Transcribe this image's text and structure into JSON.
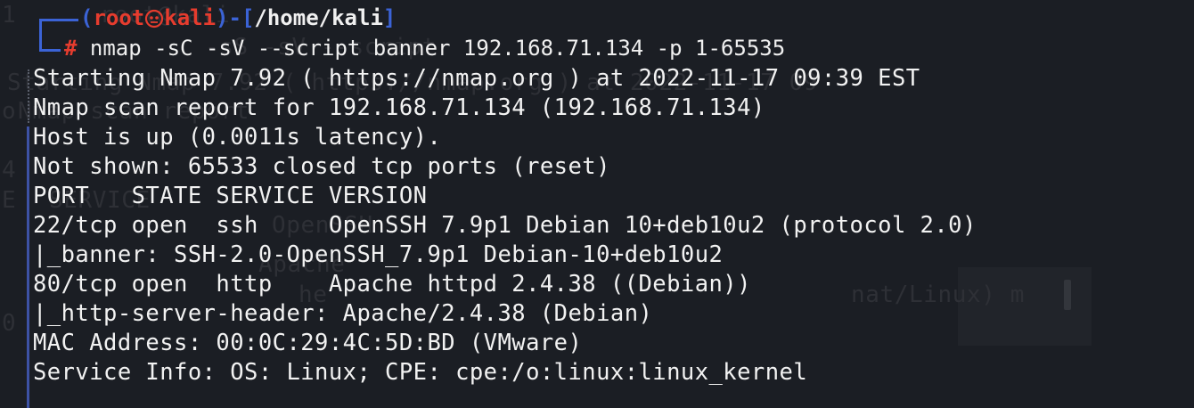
{
  "terminal": {
    "prompt": {
      "open_paren": "(",
      "user": "root",
      "host": "kali",
      "close_paren": ")-[",
      "path": "/home/kali",
      "close_bracket": "]",
      "symbol": "#",
      "command": " nmap -sC -sV --script banner 192.168.71.134 -p 1-65535"
    },
    "output_lines": [
      "Starting Nmap 7.92 ( https://nmap.org ) at 2022-11-17 09:39 EST",
      "Nmap scan report for 192.168.71.134 (192.168.71.134)",
      "Host is up (0.0011s latency).",
      "Not shown: 65533 closed tcp ports (reset)",
      "PORT   STATE SERVICE VERSION",
      "22/tcp open  ssh     OpenSSH 7.9p1 Debian 10+deb10u2 (protocol 2.0)",
      "|_banner: SSH-2.0-OpenSSH_7.9p1 Debian-10+deb10u2",
      "80/tcp open  http    Apache httpd 2.4.38 ((Debian))",
      "|_http-server-header: Apache/2.4.38 (Debian)",
      "MAC Address: 00:0C:29:4C:5D:BD (VMware)",
      "Service Info: OS: Linux; CPE: cpe:/o:linux:linux_kernel"
    ]
  },
  "background_ghost": {
    "fragments": [
      "1",
      "root@kali",
      "-sS -sV --script",
      "Starting Nmap 7.92 ( https://nmap.org ) at 2022-11-17 09",
      "o",
      "Nmap scan report",
      "4",
      "E",
      "SERVICE",
      "OpenSSH",
      "Apache",
      "he",
      "nat/Linux) m",
      "0"
    ]
  },
  "colors": {
    "background": "#1b1e24",
    "prompt_blue": "#3b63d6",
    "prompt_red": "#e63c2e",
    "text": "#f2f2f2",
    "gutter": "#3d52a5"
  },
  "icons": {
    "prompt_separator": "kali-skull-icon"
  }
}
